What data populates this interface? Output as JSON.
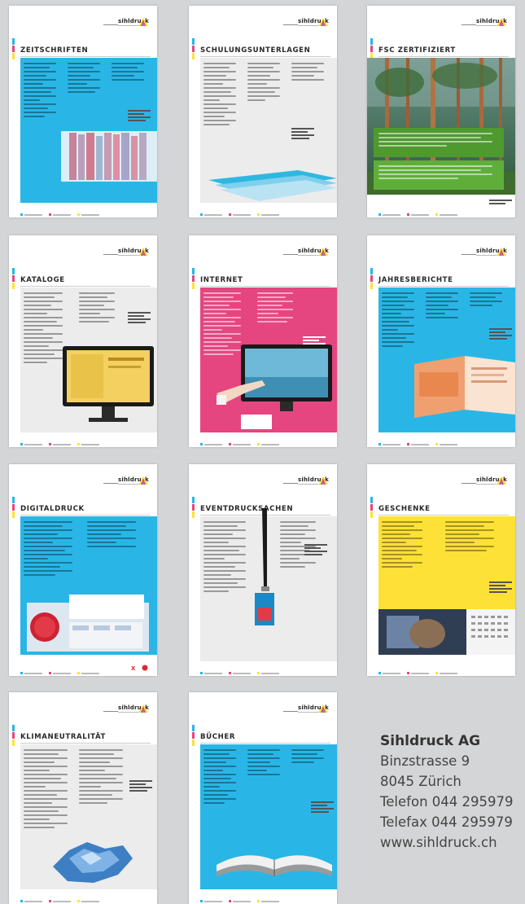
{
  "brand": {
    "logo_text": "sihldruck"
  },
  "cards": [
    {
      "title": "ZEITSCHRIFTEN"
    },
    {
      "title": "SCHULUNGSUNTERLAGEN"
    },
    {
      "title": "FSC ZERTIFIZIERT"
    },
    {
      "title": "KATALOGE"
    },
    {
      "title": "INTERNET"
    },
    {
      "title": "JAHRESBERICHTE"
    },
    {
      "title": "DIGITALDRUCK"
    },
    {
      "title": "EVENTDRUCKSACHEN"
    },
    {
      "title": "GESCHENKE"
    },
    {
      "title": "KLIMANEUTRALITÄT"
    },
    {
      "title": "BÜCHER"
    }
  ],
  "contact": {
    "company": "Sihldruck AG",
    "street": "Binzstrasse 9",
    "city": "8045 Zürich",
    "phone": "Telefon 044 295979",
    "fax": "Telefax  044 295979",
    "web": "www.sihldruck.ch"
  },
  "colors": {
    "cyan": "#29b6e6",
    "magenta": "#e5467f",
    "yellow": "#fde136",
    "green": "#5fae3a",
    "background": "#d4d5d6"
  }
}
